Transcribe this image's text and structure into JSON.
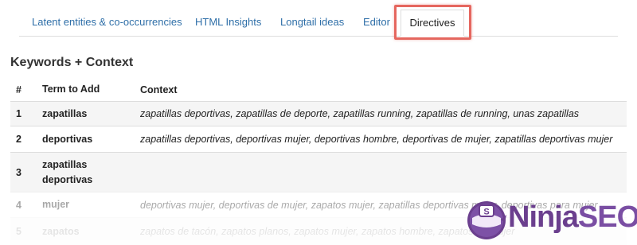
{
  "tabs": [
    {
      "label": "Latent entities & co-occurrencies"
    },
    {
      "label": "HTML Insights"
    },
    {
      "label": "Longtail ideas"
    },
    {
      "label": "Editor"
    },
    {
      "label": "Directives",
      "active": true
    }
  ],
  "section": {
    "title": "Keywords + Context"
  },
  "table": {
    "headers": {
      "num": "#",
      "term": "Term to Add",
      "context": "Context"
    },
    "rows": [
      {
        "num": "1",
        "term": "zapatillas",
        "context": "zapatillas deportivas, zapatillas de deporte, zapatillas running, zapatillas de running, unas zapatillas"
      },
      {
        "num": "2",
        "term": "deportivas",
        "context": "zapatillas deportivas, deportivas mujer, deportivas hombre, deportivas de mujer, zapatillas deportivas mujer"
      },
      {
        "num": "3",
        "term": "zapatillas deportivas",
        "context": ""
      },
      {
        "num": "4",
        "term": "mujer",
        "context": "deportivas mujer, deportivas de mujer, zapatos mujer, zapatillas deportivas mujer, deportivas para mujer"
      },
      {
        "num": "5",
        "term": "zapatos",
        "context": "zapatos de tacón, zapatos planos, zapatos mujer, zapatos hombre, zapatos de mujer"
      }
    ]
  },
  "logo": {
    "part1": "Ninja",
    "part2": "SEO",
    "badge_letter": "S"
  },
  "colors": {
    "tab_link": "#2f6fa8",
    "highlight": "#e5675f",
    "brand_purple": "#6b3f8e"
  }
}
